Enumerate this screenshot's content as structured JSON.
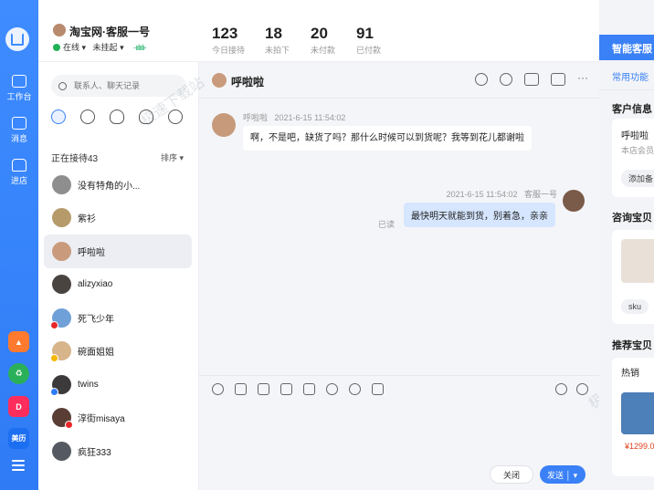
{
  "header": {
    "shop_name": "淘宝网·客服一号",
    "online_label": "在线",
    "hang_label": "未挂起",
    "stats": [
      {
        "value": "123",
        "label": "今日接待"
      },
      {
        "value": "18",
        "label": "未拍下"
      },
      {
        "value": "20",
        "label": "未付款"
      },
      {
        "value": "91",
        "label": "已付款"
      }
    ]
  },
  "rail": {
    "workbench": "工作台",
    "messages": "消息",
    "shop": "进店",
    "app_label_4": "美历"
  },
  "contacts": {
    "search_placeholder": "联系人、聊天记录",
    "serving_label": "正在接待43",
    "sort_label": "排序 ▾",
    "items": [
      {
        "name": "没有特角的小..."
      },
      {
        "name": "紫衫"
      },
      {
        "name": "呼啦啦"
      },
      {
        "name": "alizyxiao"
      },
      {
        "name": "死飞少年"
      },
      {
        "name": "碗面姐姐"
      },
      {
        "name": "twins"
      },
      {
        "name": "淳街misaya"
      },
      {
        "name": "疯狂333"
      }
    ]
  },
  "chat": {
    "title": "呼啦啦",
    "incoming": {
      "sender": "呼啦啦",
      "time": "2021-6-15 11:54:02",
      "text": "啊，不是吧，缺货了吗？那什么时候可以到货呢？我等到花儿都谢啦"
    },
    "outgoing": {
      "time": "2021-6-15 11:54:02",
      "sender": "客服一号",
      "text": "最快明天就能到货，别着急，亲亲",
      "read_label": "已读"
    },
    "close_label": "关闭",
    "send_label": "发送",
    "send_caret": "▾"
  },
  "right_panel": {
    "tab": "智能客服",
    "sub_tab": "常用功能",
    "customer_info_title": "客户信息",
    "customer_name": "呼啦啦",
    "member_label": "本店会员",
    "add_note": "添加备",
    "consult_title": "咨询宝贝",
    "sku_label": "sku",
    "recommend_title": "推荐宝贝",
    "hot_label": "热销",
    "price": "¥1299.0"
  },
  "watermark": "极速下载站",
  "colors": {
    "accent": "#3a80f6",
    "online": "#21b256",
    "price": "#e0411c"
  }
}
